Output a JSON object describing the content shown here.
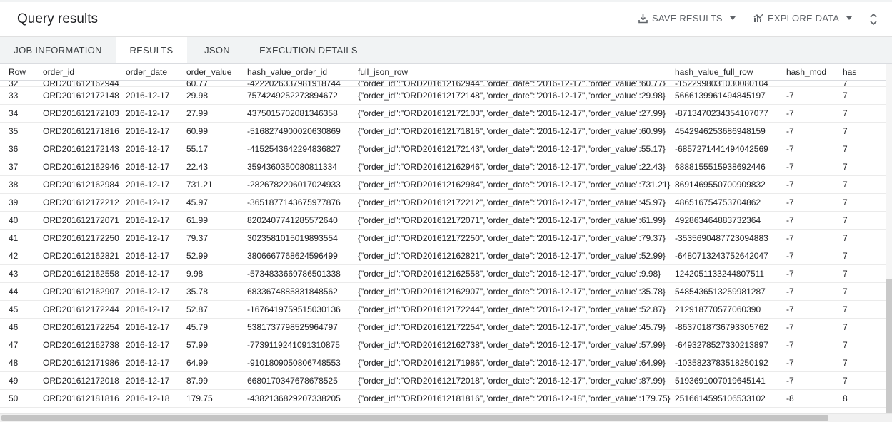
{
  "header": {
    "title": "Query results",
    "save_results": "SAVE RESULTS",
    "explore_data": "EXPLORE DATA"
  },
  "tabs": [
    {
      "label": "JOB INFORMATION",
      "active": false
    },
    {
      "label": "RESULTS",
      "active": true
    },
    {
      "label": "JSON",
      "active": false
    },
    {
      "label": "EXECUTION DETAILS",
      "active": false
    }
  ],
  "table": {
    "columns": [
      "Row",
      "order_id",
      "order_date",
      "order_value",
      "hash_value_order_id",
      "full_json_row",
      "hash_value_full_row",
      "hash_mod",
      "has"
    ],
    "partial_row": [
      "32",
      "ORD201612162944",
      "",
      "60.77",
      "-4222026337981918744",
      "{\"order_id\":\"ORD201612162944\",\"order_date\":\"2016-12-17\",\"order_value\":60.77}",
      "-1522998031030080104",
      "",
      "7"
    ],
    "rows": [
      [
        "33",
        "ORD201612172148",
        "2016-12-17",
        "29.98",
        "7574249252273894672",
        "{\"order_id\":\"ORD201612172148\",\"order_date\":\"2016-12-17\",\"order_value\":29.98}",
        "5666139961494845197",
        "-7",
        "7"
      ],
      [
        "34",
        "ORD201612172103",
        "2016-12-17",
        "27.99",
        "4375015702081346358",
        "{\"order_id\":\"ORD201612172103\",\"order_date\":\"2016-12-17\",\"order_value\":27.99}",
        "-8713470234354107077",
        "-7",
        "7"
      ],
      [
        "35",
        "ORD201612171816",
        "2016-12-17",
        "60.99",
        "-5168274900020630869",
        "{\"order_id\":\"ORD201612171816\",\"order_date\":\"2016-12-17\",\"order_value\":60.99}",
        "4542946253686948159",
        "-7",
        "7"
      ],
      [
        "36",
        "ORD201612172143",
        "2016-12-17",
        "55.17",
        "-4152543642294836827",
        "{\"order_id\":\"ORD201612172143\",\"order_date\":\"2016-12-17\",\"order_value\":55.17}",
        "-6857271441494042569",
        "-7",
        "7"
      ],
      [
        "37",
        "ORD201612162946",
        "2016-12-17",
        "22.43",
        "3594360350080811334",
        "{\"order_id\":\"ORD201612162946\",\"order_date\":\"2016-12-17\",\"order_value\":22.43}",
        "6888155515938692446",
        "-7",
        "7"
      ],
      [
        "38",
        "ORD201612162984",
        "2016-12-17",
        "731.21",
        "-2826782206017024933",
        "{\"order_id\":\"ORD201612162984\",\"order_date\":\"2016-12-17\",\"order_value\":731.21}",
        "8691469550700909832",
        "-7",
        "7"
      ],
      [
        "39",
        "ORD201612172212",
        "2016-12-17",
        "45.97",
        "-3651877143675977876",
        "{\"order_id\":\"ORD201612172212\",\"order_date\":\"2016-12-17\",\"order_value\":45.97}",
        "486516754753704862",
        "-7",
        "7"
      ],
      [
        "40",
        "ORD201612172071",
        "2016-12-17",
        "61.99",
        "8202407741285572640",
        "{\"order_id\":\"ORD201612172071\",\"order_date\":\"2016-12-17\",\"order_value\":61.99}",
        "492863464883732364",
        "-7",
        "7"
      ],
      [
        "41",
        "ORD201612172250",
        "2016-12-17",
        "79.37",
        "3023581015019893554",
        "{\"order_id\":\"ORD201612172250\",\"order_date\":\"2016-12-17\",\"order_value\":79.37}",
        "-3535690487723094883",
        "-7",
        "7"
      ],
      [
        "42",
        "ORD201612162821",
        "2016-12-17",
        "52.99",
        "3806667768624596499",
        "{\"order_id\":\"ORD201612162821\",\"order_date\":\"2016-12-17\",\"order_value\":52.99}",
        "-6480713243752642047",
        "-7",
        "7"
      ],
      [
        "43",
        "ORD201612162558",
        "2016-12-17",
        "9.98",
        "-5734833669786501338",
        "{\"order_id\":\"ORD201612162558\",\"order_date\":\"2016-12-17\",\"order_value\":9.98}",
        "1242051133244807511",
        "-7",
        "7"
      ],
      [
        "44",
        "ORD201612162907",
        "2016-12-17",
        "35.78",
        "6833674885831848562",
        "{\"order_id\":\"ORD201612162907\",\"order_date\":\"2016-12-17\",\"order_value\":35.78}",
        "5485436513259981287",
        "-7",
        "7"
      ],
      [
        "45",
        "ORD201612172244",
        "2016-12-17",
        "52.87",
        "-1676419759515030136",
        "{\"order_id\":\"ORD201612172244\",\"order_date\":\"2016-12-17\",\"order_value\":52.87}",
        "212918770577060390",
        "-7",
        "7"
      ],
      [
        "46",
        "ORD201612172254",
        "2016-12-17",
        "45.79",
        "5381737798525964797",
        "{\"order_id\":\"ORD201612172254\",\"order_date\":\"2016-12-17\",\"order_value\":45.79}",
        "-8637018736793305762",
        "-7",
        "7"
      ],
      [
        "47",
        "ORD201612162738",
        "2016-12-17",
        "57.99",
        "-7739119241091310875",
        "{\"order_id\":\"ORD201612162738\",\"order_date\":\"2016-12-17\",\"order_value\":57.99}",
        "-6493278527330213897",
        "-7",
        "7"
      ],
      [
        "48",
        "ORD201612171986",
        "2016-12-17",
        "64.99",
        "-9101809050806748553",
        "{\"order_id\":\"ORD201612171986\",\"order_date\":\"2016-12-17\",\"order_value\":64.99}",
        "-1035823783518250192",
        "-7",
        "7"
      ],
      [
        "49",
        "ORD201612172018",
        "2016-12-17",
        "87.99",
        "6680170347678678525",
        "{\"order_id\":\"ORD201612172018\",\"order_date\":\"2016-12-17\",\"order_value\":87.99}",
        "5193691007019645141",
        "-7",
        "7"
      ],
      [
        "50",
        "ORD201612181816",
        "2016-12-18",
        "179.75",
        "-4382136829207338205",
        "{\"order_id\":\"ORD201612181816\",\"order_date\":\"2016-12-18\",\"order_value\":179.75}",
        "2516614595106533102",
        "-8",
        "8"
      ]
    ]
  }
}
